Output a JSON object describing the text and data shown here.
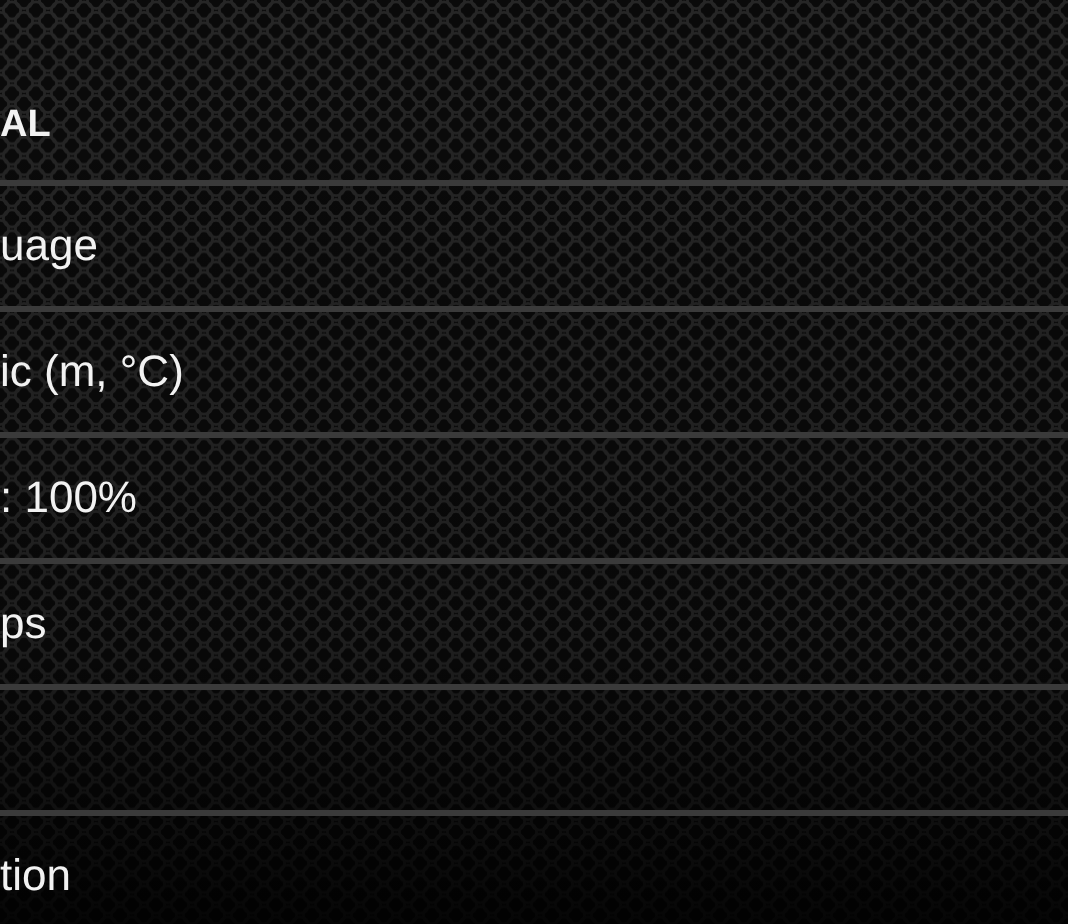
{
  "section": {
    "title": "AL"
  },
  "rows": [
    {
      "label": "uage"
    },
    {
      "label": "ic (m, °C)"
    },
    {
      "label": ": 100%"
    },
    {
      "label": "ps"
    },
    {},
    {
      "label": "tion"
    }
  ]
}
